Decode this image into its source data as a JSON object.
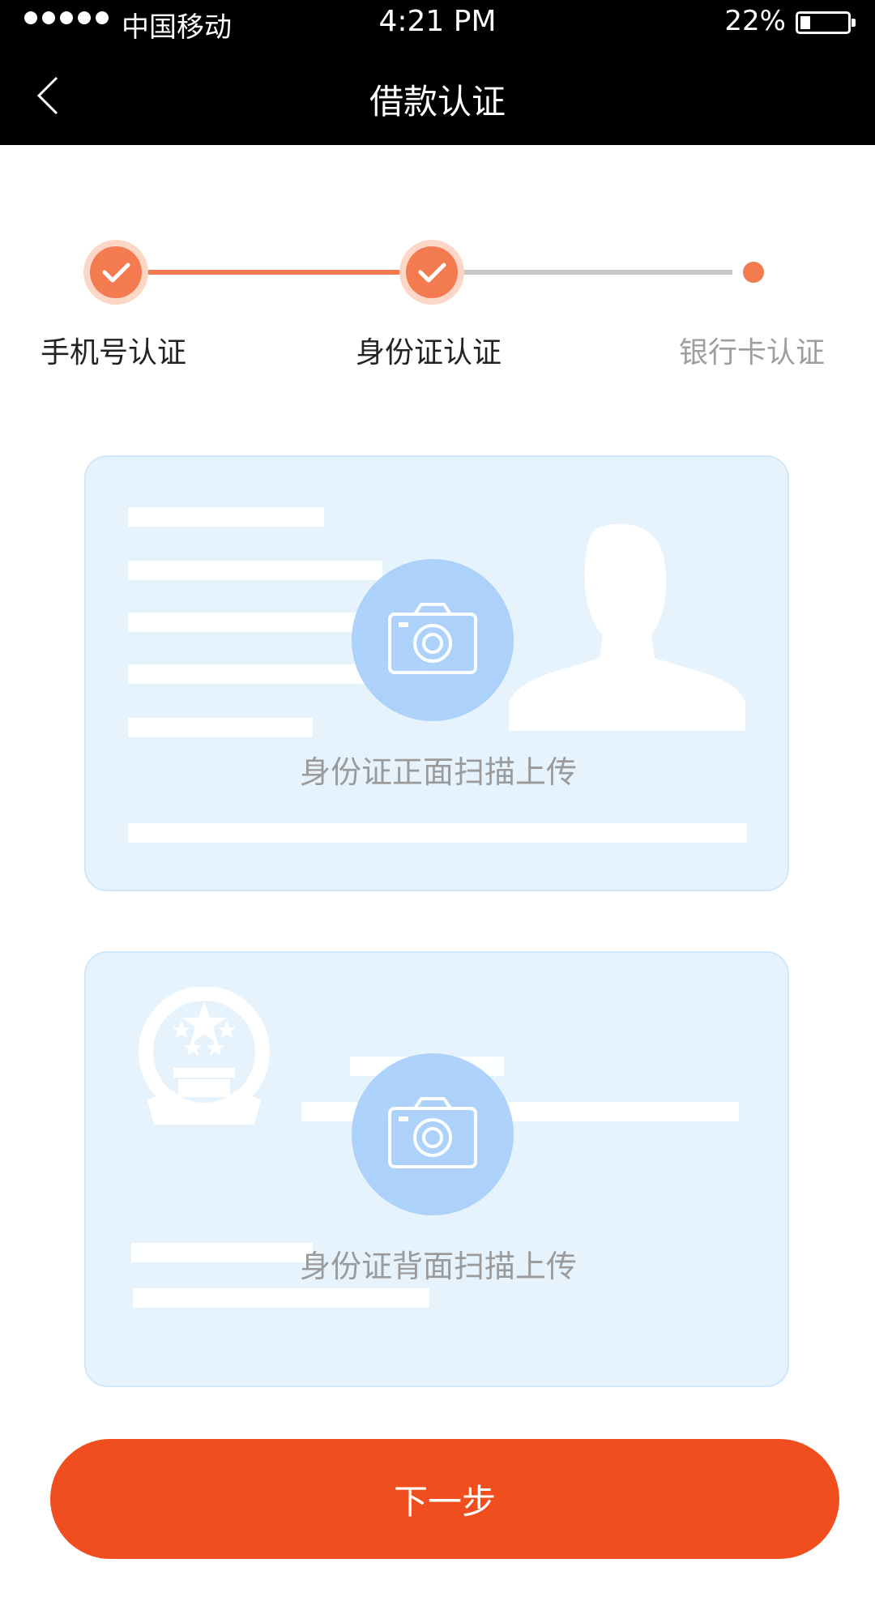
{
  "status_bar": {
    "carrier": "中国移动",
    "time": "4:21 PM",
    "battery": "22%",
    "signal_icon": "signal-dots-icon",
    "battery_icon": "battery-icon"
  },
  "nav": {
    "title": "借款认证",
    "back_icon": "chevron-left-icon"
  },
  "stepper": {
    "steps": [
      {
        "label": "手机号认证",
        "state": "completed"
      },
      {
        "label": "身份证认证",
        "state": "completed"
      },
      {
        "label": "银行卡认证",
        "state": "pending"
      }
    ]
  },
  "cards": {
    "front": {
      "label": "身份证正面扫描上传",
      "icon": "camera-icon"
    },
    "back": {
      "label": "身份证背面扫描上传",
      "icon": "camera-icon"
    }
  },
  "footer": {
    "next_label": "下一步"
  },
  "colors": {
    "accent": "#f47b50",
    "button": "#f04e1e",
    "card_bg": "#e6f3fd",
    "camera_circle": "#a9d0fb"
  }
}
